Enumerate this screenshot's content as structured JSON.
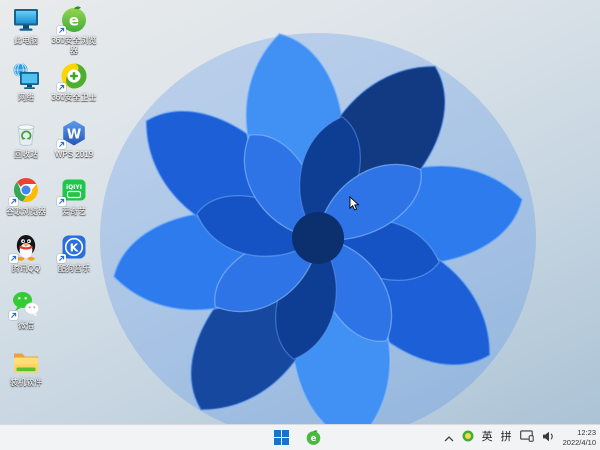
{
  "desktop": {
    "icons": [
      {
        "id": "this-pc",
        "label": "此电脑",
        "has_shortcut_arrow": false
      },
      {
        "id": "network",
        "label": "网络",
        "has_shortcut_arrow": false
      },
      {
        "id": "recycle-bin",
        "label": "回收站",
        "has_shortcut_arrow": false
      },
      {
        "id": "chrome",
        "label": "谷歌浏览器",
        "has_shortcut_arrow": true
      },
      {
        "id": "qq",
        "label": "腾讯QQ",
        "has_shortcut_arrow": true
      },
      {
        "id": "wechat",
        "label": "微信",
        "has_shortcut_arrow": true
      },
      {
        "id": "software-folder",
        "label": "装机软件",
        "has_shortcut_arrow": false
      },
      {
        "id": "360-browser",
        "label": "360安全浏览器",
        "has_shortcut_arrow": true
      },
      {
        "id": "360-safety",
        "label": "360安全卫士",
        "has_shortcut_arrow": true
      },
      {
        "id": "wps",
        "label": "WPS 2019",
        "has_shortcut_arrow": true
      },
      {
        "id": "iqiyi",
        "label": "爱奇艺",
        "has_shortcut_arrow": true
      },
      {
        "id": "kugou",
        "label": "酷狗音乐",
        "has_shortcut_arrow": true
      }
    ]
  },
  "icon_glyphs": {
    "browser_e": "e",
    "wps_w": "W",
    "iqiyi_text": "iQIYI",
    "kugou_k": "K"
  },
  "taskbar": {
    "tray": {
      "ime_english": "英",
      "ime_pinyin": "拼"
    },
    "clock": {
      "time": "12:23",
      "date": "2022/4/10"
    }
  },
  "colors": {
    "bloom_bright_blue": "#2e7bed",
    "bloom_dark_blue": "#123a82",
    "wallpaper_top": "#e9ebec",
    "wallpaper_bottom": "#abc3d6",
    "taskbar_bg": "#f1f3f5",
    "start_blue": "#1573d1"
  }
}
